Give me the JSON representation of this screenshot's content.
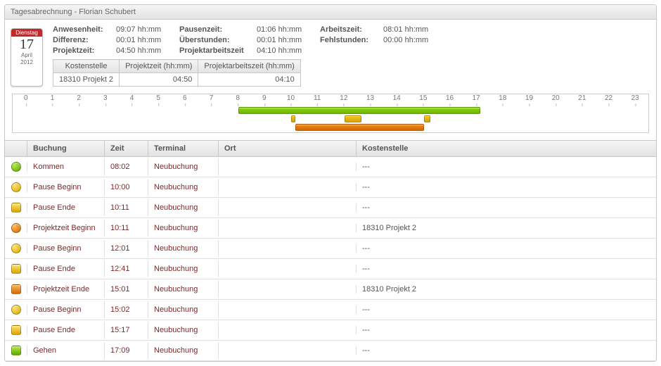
{
  "title": "Tagesabrechnung - Florian Schubert",
  "calendar": {
    "dow": "Dienstag",
    "day": "17",
    "month": "April",
    "year": "2012"
  },
  "summary": {
    "anwesenheit": {
      "label": "Anwesenheit:",
      "value": "09:07 hh:mm"
    },
    "differenz": {
      "label": "Differenz:",
      "value": "00:01 hh:mm"
    },
    "projektzeit": {
      "label": "Projektzeit:",
      "value": "04:50 hh:mm"
    },
    "pausenzeit": {
      "label": "Pausenzeit:",
      "value": "01:06 hh:mm"
    },
    "ueberstunden": {
      "label": "Überstunden:",
      "value": "00:01 hh:mm"
    },
    "projektarbeitszeit": {
      "label": "Projektarbeitszeit",
      "value": "04:10 hh:mm"
    },
    "arbeitszeit": {
      "label": "Arbeitszeit:",
      "value": "08:01 hh:mm"
    },
    "fehlstunden": {
      "label": "Fehlstunden:",
      "value": "00:00 hh:mm"
    }
  },
  "cc_table": {
    "headers": {
      "cc": "Kostenstelle",
      "pz": "Projektzeit (hh:mm)",
      "paz": "Projektarbeitszeit (hh:mm)"
    },
    "rows": [
      {
        "cc": "18310 Projekt 2",
        "pz": "04:50",
        "paz": "04:10"
      }
    ]
  },
  "timeline": {
    "hours": [
      "0",
      "1",
      "2",
      "3",
      "4",
      "5",
      "6",
      "7",
      "8",
      "9",
      "10",
      "11",
      "12",
      "13",
      "14",
      "15",
      "16",
      "17",
      "18",
      "19",
      "20",
      "21",
      "22",
      "23"
    ],
    "bars": [
      {
        "row": 0,
        "color": "green",
        "start": 8.03,
        "end": 17.15
      },
      {
        "row": 1,
        "color": "yellow",
        "start": 10.0,
        "end": 10.18
      },
      {
        "row": 1,
        "color": "yellow",
        "start": 12.02,
        "end": 12.68
      },
      {
        "row": 1,
        "color": "yellow",
        "start": 15.03,
        "end": 15.28
      },
      {
        "row": 2,
        "color": "orange",
        "start": 10.18,
        "end": 15.02
      }
    ]
  },
  "grid": {
    "headers": {
      "booking": "Buchung",
      "time": "Zeit",
      "terminal": "Terminal",
      "ort": "Ort",
      "cc": "Kostenstelle"
    },
    "rows": [
      {
        "icon": "dot-green",
        "booking": "Kommen",
        "time": "08:02",
        "terminal": "Neubuchung",
        "ort": "",
        "cc": "---"
      },
      {
        "icon": "dot-yellow",
        "booking": "Pause Beginn",
        "time": "10:00",
        "terminal": "Neubuchung",
        "ort": "",
        "cc": "---"
      },
      {
        "icon": "sq-yellow",
        "booking": "Pause Ende",
        "time": "10:11",
        "terminal": "Neubuchung",
        "ort": "",
        "cc": "---"
      },
      {
        "icon": "dot-orange",
        "booking": "Projektzeit Beginn",
        "time": "10:11",
        "terminal": "Neubuchung",
        "ort": "",
        "cc": "18310 Projekt 2"
      },
      {
        "icon": "dot-yellow",
        "booking": "Pause Beginn",
        "time": "12:01",
        "terminal": "Neubuchung",
        "ort": "",
        "cc": "---"
      },
      {
        "icon": "sq-yellow",
        "booking": "Pause Ende",
        "time": "12:41",
        "terminal": "Neubuchung",
        "ort": "",
        "cc": "---"
      },
      {
        "icon": "sq-orange",
        "booking": "Projektzeit Ende",
        "time": "15:01",
        "terminal": "Neubuchung",
        "ort": "",
        "cc": "18310 Projekt 2"
      },
      {
        "icon": "dot-yellow",
        "booking": "Pause Beginn",
        "time": "15:02",
        "terminal": "Neubuchung",
        "ort": "",
        "cc": "---"
      },
      {
        "icon": "sq-yellow",
        "booking": "Pause Ende",
        "time": "15:17",
        "terminal": "Neubuchung",
        "ort": "",
        "cc": "---"
      },
      {
        "icon": "sq-green",
        "booking": "Gehen",
        "time": "17:09",
        "terminal": "Neubuchung",
        "ort": "",
        "cc": "---"
      }
    ]
  }
}
